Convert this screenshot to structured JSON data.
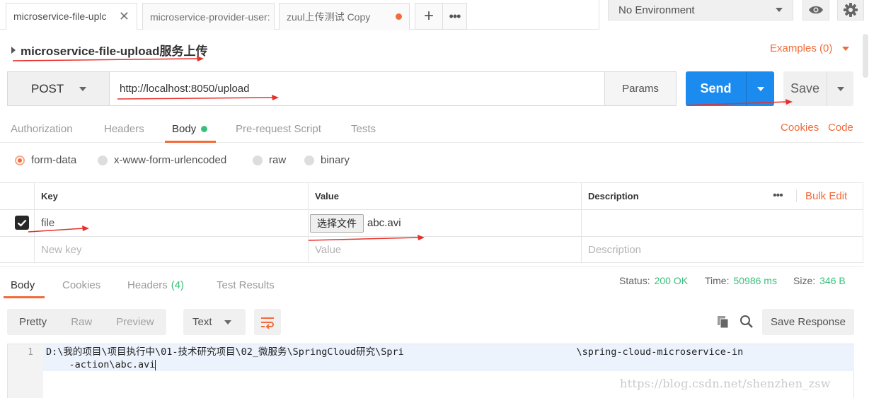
{
  "tabs": [
    {
      "label": "microservice-file-uplc",
      "active": true,
      "close": "✕"
    },
    {
      "label": "microservice-provider-user:",
      "active": false
    },
    {
      "label": "zuul上传测试 Copy",
      "active": false,
      "unsaved": true
    }
  ],
  "tab_actions": {
    "add": "+",
    "more": "•••"
  },
  "environment": {
    "selected": "No Environment"
  },
  "request": {
    "name": "microservice-file-upload服务上传",
    "examples": "Examples (0)",
    "method": "POST",
    "url": "http://localhost:8050/upload",
    "params": "Params",
    "send": "Send",
    "save": "Save"
  },
  "request_tabs": [
    "Authorization",
    "Headers",
    "Body",
    "Pre-request Script",
    "Tests"
  ],
  "request_links": {
    "cookies": "Cookies",
    "code": "Code"
  },
  "body_modes": [
    "form-data",
    "x-www-form-urlencoded",
    "raw",
    "binary"
  ],
  "form_table": {
    "headers": {
      "key": "Key",
      "value": "Value",
      "description": "Description"
    },
    "more": "•••",
    "bulk_edit": "Bulk Edit",
    "row": {
      "key": "file",
      "file_button": "选择文件",
      "file_name": "abc.avi"
    },
    "placeholders": {
      "key": "New key",
      "value": "Value",
      "description": "Description"
    }
  },
  "response_tabs": {
    "body": "Body",
    "cookies": "Cookies",
    "headers": "Headers",
    "headers_count": "(4)",
    "test_results": "Test Results"
  },
  "response_status": {
    "status_label": "Status:",
    "status_value": "200 OK",
    "time_label": "Time:",
    "time_value": "50986 ms",
    "size_label": "Size:",
    "size_value": "346 B"
  },
  "response_toolbar": {
    "views": [
      "Pretty",
      "Raw",
      "Preview"
    ],
    "format": "Text",
    "save_response": "Save Response"
  },
  "response_body": {
    "line_number": "1",
    "text": "D:\\我的项目\\项目执行中\\01-技术研究项目\\02_微服务\\SpringCloud研究\\Spri                              \\spring-cloud-microservice-in\n    -action\\abc.avi"
  },
  "watermark": "https://blog.csdn.net/shenzhen_zsw",
  "colors": {
    "accent": "#f26b3a",
    "send": "#1b8bf0",
    "success": "#3cbf7c"
  }
}
